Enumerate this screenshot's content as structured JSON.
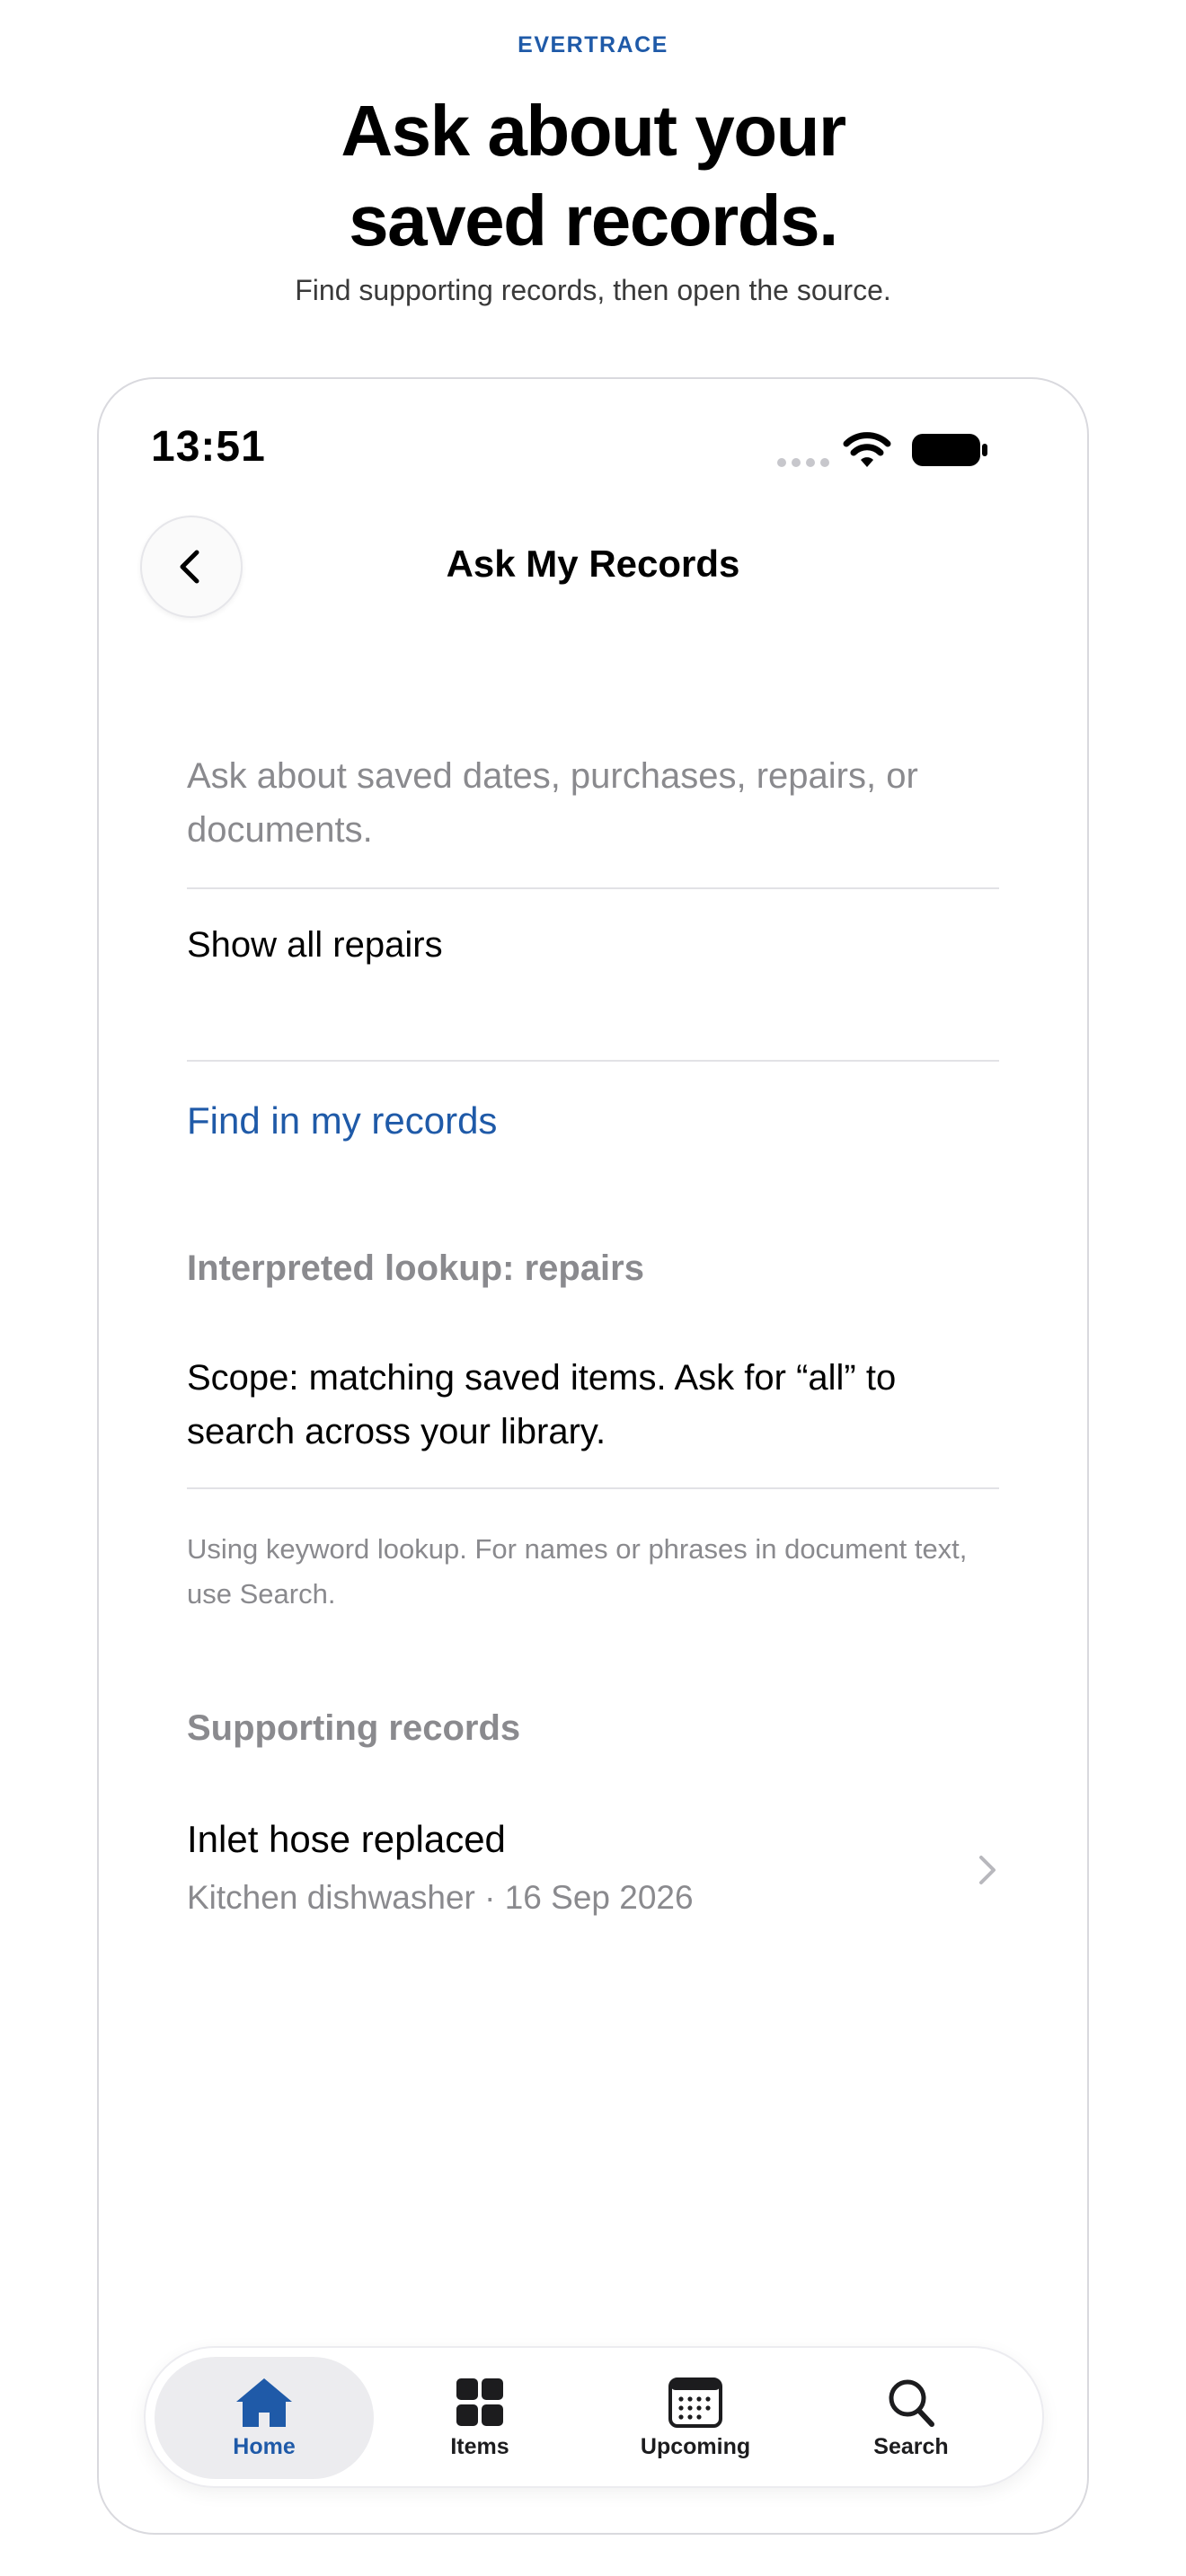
{
  "header": {
    "brand": "EVERTRACE",
    "headline_line1": "Ask about your",
    "headline_line2": "saved records.",
    "subhead": "Find supporting records, then open the source."
  },
  "status_bar": {
    "time": "13:51"
  },
  "nav": {
    "title": "Ask My Records",
    "back_icon": "chevron-left-icon"
  },
  "ask": {
    "placeholder": "Ask about saved dates, purchases, repairs, or documents.",
    "query_value": "Show all repairs",
    "find_label": "Find in my records"
  },
  "interpretation": {
    "label": "Interpreted lookup: repairs",
    "scope": "Scope: matching saved items. Ask for “all” to search across your library.",
    "note": "Using keyword lookup. For names or phrases in document text, use Search."
  },
  "supporting": {
    "label": "Supporting records",
    "records": [
      {
        "title": "Inlet hose replaced",
        "meta": "Kitchen dishwasher · 16 Sep 2026"
      }
    ]
  },
  "tabs": [
    {
      "label": "Home",
      "icon": "home-icon",
      "active": true
    },
    {
      "label": "Items",
      "icon": "grid-icon",
      "active": false
    },
    {
      "label": "Upcoming",
      "icon": "calendar-icon",
      "active": false
    },
    {
      "label": "Search",
      "icon": "search-icon",
      "active": false
    }
  ],
  "colors": {
    "accent": "#1f5aa8",
    "secondary_text": "#8a8a8e",
    "divider": "#e2e2e6"
  }
}
